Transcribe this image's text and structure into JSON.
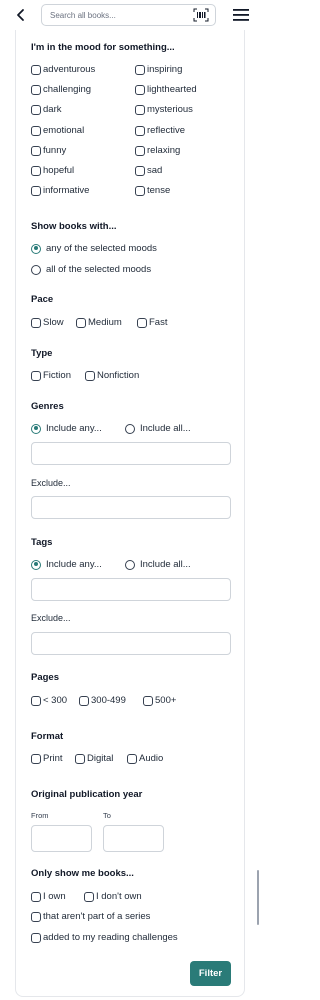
{
  "header": {
    "search_placeholder": "Search all books..."
  },
  "mood": {
    "heading": "I'm in the mood for something...",
    "options": [
      "adventurous",
      "inspiring",
      "challenging",
      "lighthearted",
      "dark",
      "mysterious",
      "emotional",
      "reflective",
      "funny",
      "relaxing",
      "hopeful",
      "sad",
      "informative",
      "tense"
    ]
  },
  "show_books": {
    "heading": "Show books with...",
    "options": [
      "any of the selected moods",
      "all of the selected moods"
    ],
    "selected": 0
  },
  "pace": {
    "heading": "Pace",
    "options": [
      "Slow",
      "Medium",
      "Fast"
    ]
  },
  "type": {
    "heading": "Type",
    "options": [
      "Fiction",
      "Nonfiction"
    ]
  },
  "genres": {
    "heading": "Genres",
    "include_any": "Include any...",
    "include_all": "Include all...",
    "selected": "any",
    "exclude_label": "Exclude..."
  },
  "tags": {
    "heading": "Tags",
    "include_any": "Include any...",
    "include_all": "Include all...",
    "selected": "any",
    "exclude_label": "Exclude..."
  },
  "pages": {
    "heading": "Pages",
    "options": [
      "< 300",
      "300-499",
      "500+"
    ]
  },
  "format": {
    "heading": "Format",
    "options": [
      "Print",
      "Digital",
      "Audio"
    ]
  },
  "year": {
    "heading": "Original publication year",
    "from_label": "From",
    "to_label": "To"
  },
  "only_show": {
    "heading": "Only show me books...",
    "options": [
      "I own",
      "I don't own",
      "that aren't part of a series",
      "added to my reading challenges"
    ]
  },
  "filter_button": "Filter",
  "colors": {
    "accent": "#2a7b78"
  }
}
